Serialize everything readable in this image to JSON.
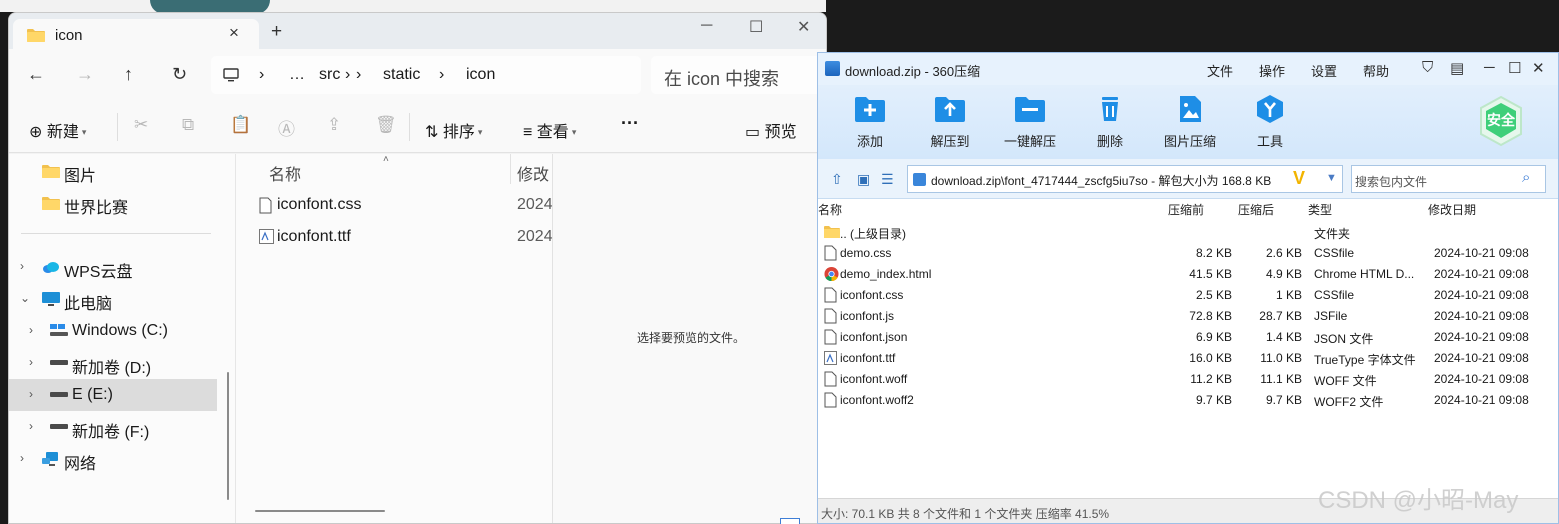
{
  "explorer": {
    "tab_title": "icon",
    "new_tab": "+",
    "window_controls": [
      "─",
      "☐",
      "✕"
    ],
    "breadcrumb": [
      "…",
      "src",
      "static",
      "icon"
    ],
    "search_placeholder": "在 icon 中搜索",
    "toolbar": {
      "new": "新建",
      "sort": "排序",
      "view": "查看",
      "more": "···",
      "preview": "预览"
    },
    "sidebar": [
      {
        "label": "图片",
        "icon": "folder-icon",
        "chevron": false,
        "selected": false
      },
      {
        "label": "世界比赛",
        "icon": "folder-icon",
        "chevron": false,
        "selected": false
      },
      {
        "label": "WPS云盘",
        "icon": "cloud-icon",
        "chevron": true,
        "selected": false
      },
      {
        "label": "此电脑",
        "icon": "computer-icon",
        "chevron": true,
        "expanded": true,
        "selected": false
      },
      {
        "label": "Windows (C:)",
        "icon": "windows-drive-icon",
        "chevron": true,
        "selected": false
      },
      {
        "label": "新加卷 (D:)",
        "icon": "drive-icon",
        "chevron": true,
        "selected": false
      },
      {
        "label": "E (E:)",
        "icon": "drive-icon",
        "chevron": true,
        "selected": true
      },
      {
        "label": "新加卷 (F:)",
        "icon": "drive-icon",
        "chevron": true,
        "selected": false
      },
      {
        "label": "网络",
        "icon": "network-icon",
        "chevron": true,
        "selected": false
      }
    ],
    "columns": {
      "name": "名称",
      "modified": "修改"
    },
    "files": [
      {
        "name": "iconfont.css",
        "date": "2024",
        "icon": "file-icon"
      },
      {
        "name": "iconfont.ttf",
        "date": "2024",
        "icon": "font-file-icon"
      }
    ],
    "preview_text": "选择要预览的文件。"
  },
  "zip": {
    "title": "download.zip - 360压缩",
    "menu": [
      "文件",
      "操作",
      "设置",
      "帮助"
    ],
    "tools": [
      {
        "label": "添加",
        "icon": "add-icon"
      },
      {
        "label": "解压到",
        "icon": "extract-to-icon"
      },
      {
        "label": "一键解压",
        "icon": "one-click-extract-icon"
      },
      {
        "label": "删除",
        "icon": "delete-icon"
      },
      {
        "label": "图片压缩",
        "icon": "image-compress-icon"
      },
      {
        "label": "工具",
        "icon": "tools-icon"
      }
    ],
    "safe_badge": "安全",
    "path": "download.zip\\font_4717444_zscfg5iu7so - 解包大小为 168.8 KB",
    "search_placeholder": "搜索包内文件",
    "headers": {
      "name": "名称",
      "compressed": "压缩前",
      "packed": "压缩后",
      "type": "类型",
      "modified": "修改日期"
    },
    "rows": [
      {
        "name": ".. (上级目录)",
        "before": "",
        "after": "",
        "type": "文件夹",
        "date": "",
        "icon": "folder-icon"
      },
      {
        "name": "demo.css",
        "before": "8.2 KB",
        "after": "2.6 KB",
        "type": "CSSfile",
        "date": "2024-10-21 09:08",
        "icon": "file-icon"
      },
      {
        "name": "demo_index.html",
        "before": "41.5 KB",
        "after": "4.9 KB",
        "type": "Chrome HTML D...",
        "date": "2024-10-21 09:08",
        "icon": "chrome-icon"
      },
      {
        "name": "iconfont.css",
        "before": "2.5 KB",
        "after": "1 KB",
        "type": "CSSfile",
        "date": "2024-10-21 09:08",
        "icon": "file-icon"
      },
      {
        "name": "iconfont.js",
        "before": "72.8 KB",
        "after": "28.7 KB",
        "type": "JSFile",
        "date": "2024-10-21 09:08",
        "icon": "file-icon"
      },
      {
        "name": "iconfont.json",
        "before": "6.9 KB",
        "after": "1.4 KB",
        "type": "JSON 文件",
        "date": "2024-10-21 09:08",
        "icon": "file-icon"
      },
      {
        "name": "iconfont.ttf",
        "before": "16.0 KB",
        "after": "11.0 KB",
        "type": "TrueType 字体文件",
        "date": "2024-10-21 09:08",
        "icon": "font-file-icon"
      },
      {
        "name": "iconfont.woff",
        "before": "11.2 KB",
        "after": "11.1 KB",
        "type": "WOFF 文件",
        "date": "2024-10-21 09:08",
        "icon": "file-icon"
      },
      {
        "name": "iconfont.woff2",
        "before": "9.7 KB",
        "after": "9.7 KB",
        "type": "WOFF2 文件",
        "date": "2024-10-21 09:08",
        "icon": "file-icon"
      }
    ],
    "status": "大小: 70.1 KB 共 8 个文件和 1 个文件夹 压缩率 41.5%"
  },
  "watermark": "CSDN @小昭-May",
  "colors": {
    "zip_accent": "#2f8fe0",
    "safe_green": "#3fcf7a",
    "selection": "#dcdcdc"
  }
}
